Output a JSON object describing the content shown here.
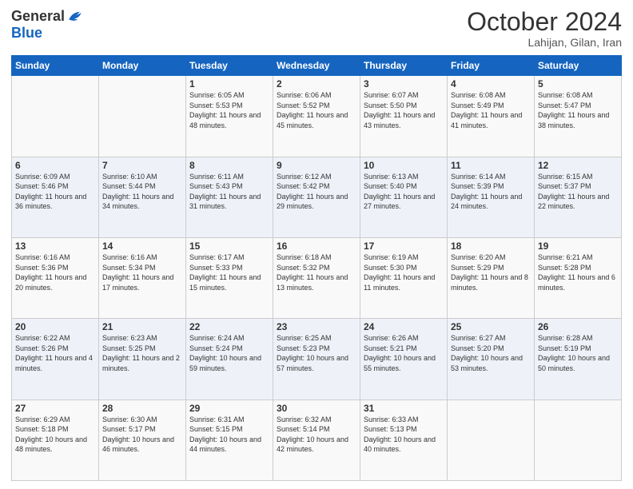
{
  "header": {
    "logo_general": "General",
    "logo_blue": "Blue",
    "month": "October 2024",
    "location": "Lahijan, Gilan, Iran"
  },
  "days_of_week": [
    "Sunday",
    "Monday",
    "Tuesday",
    "Wednesday",
    "Thursday",
    "Friday",
    "Saturday"
  ],
  "weeks": [
    [
      {
        "day": "",
        "info": ""
      },
      {
        "day": "",
        "info": ""
      },
      {
        "day": "1",
        "info": "Sunrise: 6:05 AM\nSunset: 5:53 PM\nDaylight: 11 hours and 48 minutes."
      },
      {
        "day": "2",
        "info": "Sunrise: 6:06 AM\nSunset: 5:52 PM\nDaylight: 11 hours and 45 minutes."
      },
      {
        "day": "3",
        "info": "Sunrise: 6:07 AM\nSunset: 5:50 PM\nDaylight: 11 hours and 43 minutes."
      },
      {
        "day": "4",
        "info": "Sunrise: 6:08 AM\nSunset: 5:49 PM\nDaylight: 11 hours and 41 minutes."
      },
      {
        "day": "5",
        "info": "Sunrise: 6:08 AM\nSunset: 5:47 PM\nDaylight: 11 hours and 38 minutes."
      }
    ],
    [
      {
        "day": "6",
        "info": "Sunrise: 6:09 AM\nSunset: 5:46 PM\nDaylight: 11 hours and 36 minutes."
      },
      {
        "day": "7",
        "info": "Sunrise: 6:10 AM\nSunset: 5:44 PM\nDaylight: 11 hours and 34 minutes."
      },
      {
        "day": "8",
        "info": "Sunrise: 6:11 AM\nSunset: 5:43 PM\nDaylight: 11 hours and 31 minutes."
      },
      {
        "day": "9",
        "info": "Sunrise: 6:12 AM\nSunset: 5:42 PM\nDaylight: 11 hours and 29 minutes."
      },
      {
        "day": "10",
        "info": "Sunrise: 6:13 AM\nSunset: 5:40 PM\nDaylight: 11 hours and 27 minutes."
      },
      {
        "day": "11",
        "info": "Sunrise: 6:14 AM\nSunset: 5:39 PM\nDaylight: 11 hours and 24 minutes."
      },
      {
        "day": "12",
        "info": "Sunrise: 6:15 AM\nSunset: 5:37 PM\nDaylight: 11 hours and 22 minutes."
      }
    ],
    [
      {
        "day": "13",
        "info": "Sunrise: 6:16 AM\nSunset: 5:36 PM\nDaylight: 11 hours and 20 minutes."
      },
      {
        "day": "14",
        "info": "Sunrise: 6:16 AM\nSunset: 5:34 PM\nDaylight: 11 hours and 17 minutes."
      },
      {
        "day": "15",
        "info": "Sunrise: 6:17 AM\nSunset: 5:33 PM\nDaylight: 11 hours and 15 minutes."
      },
      {
        "day": "16",
        "info": "Sunrise: 6:18 AM\nSunset: 5:32 PM\nDaylight: 11 hours and 13 minutes."
      },
      {
        "day": "17",
        "info": "Sunrise: 6:19 AM\nSunset: 5:30 PM\nDaylight: 11 hours and 11 minutes."
      },
      {
        "day": "18",
        "info": "Sunrise: 6:20 AM\nSunset: 5:29 PM\nDaylight: 11 hours and 8 minutes."
      },
      {
        "day": "19",
        "info": "Sunrise: 6:21 AM\nSunset: 5:28 PM\nDaylight: 11 hours and 6 minutes."
      }
    ],
    [
      {
        "day": "20",
        "info": "Sunrise: 6:22 AM\nSunset: 5:26 PM\nDaylight: 11 hours and 4 minutes."
      },
      {
        "day": "21",
        "info": "Sunrise: 6:23 AM\nSunset: 5:25 PM\nDaylight: 11 hours and 2 minutes."
      },
      {
        "day": "22",
        "info": "Sunrise: 6:24 AM\nSunset: 5:24 PM\nDaylight: 10 hours and 59 minutes."
      },
      {
        "day": "23",
        "info": "Sunrise: 6:25 AM\nSunset: 5:23 PM\nDaylight: 10 hours and 57 minutes."
      },
      {
        "day": "24",
        "info": "Sunrise: 6:26 AM\nSunset: 5:21 PM\nDaylight: 10 hours and 55 minutes."
      },
      {
        "day": "25",
        "info": "Sunrise: 6:27 AM\nSunset: 5:20 PM\nDaylight: 10 hours and 53 minutes."
      },
      {
        "day": "26",
        "info": "Sunrise: 6:28 AM\nSunset: 5:19 PM\nDaylight: 10 hours and 50 minutes."
      }
    ],
    [
      {
        "day": "27",
        "info": "Sunrise: 6:29 AM\nSunset: 5:18 PM\nDaylight: 10 hours and 48 minutes."
      },
      {
        "day": "28",
        "info": "Sunrise: 6:30 AM\nSunset: 5:17 PM\nDaylight: 10 hours and 46 minutes."
      },
      {
        "day": "29",
        "info": "Sunrise: 6:31 AM\nSunset: 5:15 PM\nDaylight: 10 hours and 44 minutes."
      },
      {
        "day": "30",
        "info": "Sunrise: 6:32 AM\nSunset: 5:14 PM\nDaylight: 10 hours and 42 minutes."
      },
      {
        "day": "31",
        "info": "Sunrise: 6:33 AM\nSunset: 5:13 PM\nDaylight: 10 hours and 40 minutes."
      },
      {
        "day": "",
        "info": ""
      },
      {
        "day": "",
        "info": ""
      }
    ]
  ]
}
